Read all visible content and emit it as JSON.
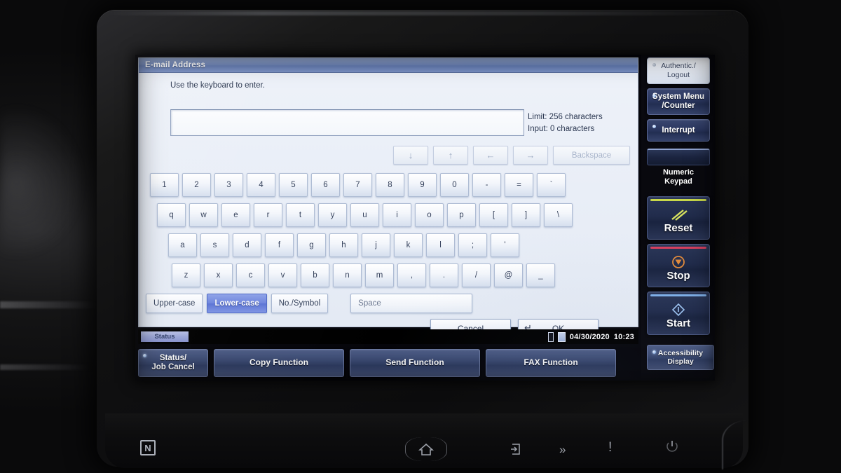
{
  "dialog": {
    "title": "E-mail Address",
    "instruction": "Use the keyboard to enter.",
    "input_value": "",
    "limit_text": "Limit: 256 characters",
    "input_text": "Input: 0 characters",
    "nav_keys": [
      {
        "name": "arrow-down",
        "label": "↓"
      },
      {
        "name": "arrow-up",
        "label": "↑"
      },
      {
        "name": "arrow-left",
        "label": "←"
      },
      {
        "name": "arrow-right",
        "label": "→"
      }
    ],
    "backspace_label": "Backspace",
    "keyboard_rows": [
      [
        "1",
        "2",
        "3",
        "4",
        "5",
        "6",
        "7",
        "8",
        "9",
        "0",
        "-",
        "=",
        "`"
      ],
      [
        "q",
        "w",
        "e",
        "r",
        "t",
        "y",
        "u",
        "i",
        "o",
        "p",
        "[",
        "]",
        "\\"
      ],
      [
        "a",
        "s",
        "d",
        "f",
        "g",
        "h",
        "j",
        "k",
        "l",
        ";",
        "'"
      ],
      [
        "z",
        "x",
        "c",
        "v",
        "b",
        "n",
        "m",
        ",",
        ".",
        "/",
        "@",
        "_"
      ]
    ],
    "case_buttons": [
      {
        "label": "Upper-case",
        "selected": false
      },
      {
        "label": "Lower-case",
        "selected": true
      },
      {
        "label": "No./Symbol",
        "selected": false
      }
    ],
    "space_label": "Space",
    "cancel_label": "Cancel",
    "ok_label": "OK",
    "ok_enter_glyph": "↵"
  },
  "statusbar": {
    "tab_label": "Status",
    "date": "04/30/2020",
    "time": "10:23"
  },
  "function_buttons": [
    {
      "label_line1": "Status/",
      "label_line2": "Job Cancel",
      "led": true
    },
    {
      "label_line1": "Copy Function",
      "label_line2": "",
      "led": false
    },
    {
      "label_line1": "Send Function",
      "label_line2": "",
      "led": false
    },
    {
      "label_line1": "FAX Function",
      "label_line2": "",
      "led": false
    }
  ],
  "hardkeys": {
    "authentic": {
      "line1": "Authentic./",
      "line2": "Logout"
    },
    "system_menu": {
      "line1": "System Menu",
      "line2": "/Counter"
    },
    "interrupt": {
      "line1": "Interrupt",
      "line2": ""
    },
    "numeric_keypad": {
      "line1": "Numeric",
      "line2": "Keypad"
    },
    "reset": {
      "label": "Reset",
      "accent": "#c8d84a"
    },
    "stop": {
      "label": "Stop",
      "accent": "#d9405e",
      "icon_color": "#e08a3c"
    },
    "start": {
      "label": "Start",
      "accent": "#7fb0e8"
    },
    "accessibility": {
      "line1": "Accessibility",
      "line2": "Display"
    }
  },
  "bezel": {
    "nfc_label": "N",
    "home_icon": "home-icon",
    "eject_icon": "document-eject-icon",
    "chevrons": "»",
    "alert": "!",
    "power_icon": "power-icon"
  }
}
